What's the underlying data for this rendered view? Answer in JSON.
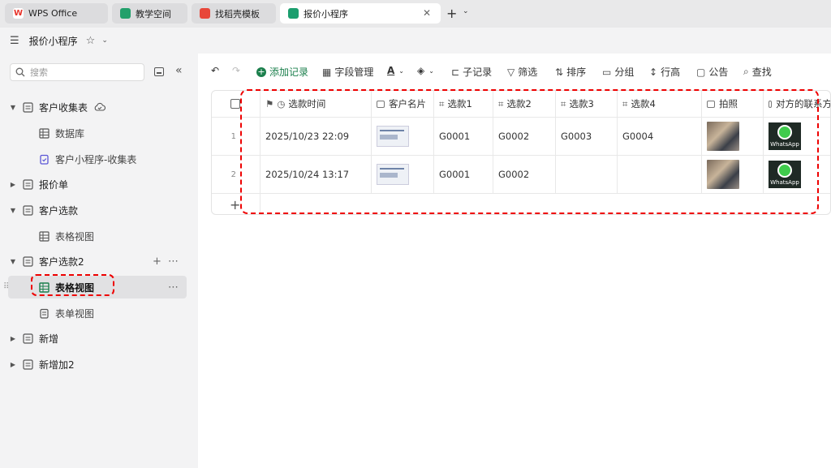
{
  "tabs": [
    {
      "label": "WPS Office",
      "icon": "wps-logo-icon",
      "color": "#e8332a"
    },
    {
      "label": "教学空间",
      "icon": "teaching-space-icon",
      "color": "#22a06b"
    },
    {
      "label": "找稻壳模板",
      "icon": "docer-icon",
      "color": "#e8473a"
    },
    {
      "label": "报价小程序",
      "icon": "multidim-table-icon",
      "color": "#1b9e6e"
    }
  ],
  "header": {
    "title": "报价小程序"
  },
  "sidebar": {
    "search_placeholder": "搜索",
    "tree": [
      {
        "label": "客户收集表",
        "type": "folder"
      },
      {
        "label": "数据库",
        "type": "grid"
      },
      {
        "label": "客户小程序-收集表",
        "type": "form"
      },
      {
        "label": "报价单",
        "type": "folder"
      },
      {
        "label": "客户选款",
        "type": "folder"
      },
      {
        "label": "表格视图",
        "type": "grid"
      },
      {
        "label": "客户选款2",
        "type": "folder"
      },
      {
        "label": "表格视图",
        "type": "grid",
        "selected": true
      },
      {
        "label": "表单视图",
        "type": "form"
      },
      {
        "label": "新增",
        "type": "folder"
      },
      {
        "label": "新增加2",
        "type": "folder"
      }
    ]
  },
  "toolbar": {
    "add_record": "添加记录",
    "field_manage": "字段管理",
    "sub_record": "子记录",
    "filter": "筛选",
    "sort": "排序",
    "group": "分组",
    "row_height": "行高",
    "notice": "公告",
    "find": "查找"
  },
  "table": {
    "columns": [
      "选款时间",
      "客户名片",
      "选款1",
      "选款2",
      "选款3",
      "选款4",
      "拍照",
      "对方的联系方"
    ],
    "rows": [
      {
        "num": "1",
        "time": "2025/10/23 22:09",
        "s1": "G0001",
        "s2": "G0002",
        "s3": "G0003",
        "s4": "G0004"
      },
      {
        "num": "2",
        "time": "2025/10/24 13:17",
        "s1": "G0001",
        "s2": "G0002",
        "s3": "",
        "s4": ""
      }
    ],
    "whatsapp_label": "WhatsApp"
  },
  "colors": {
    "accent": "#1b7f4c",
    "highlight": "#ee0000"
  }
}
